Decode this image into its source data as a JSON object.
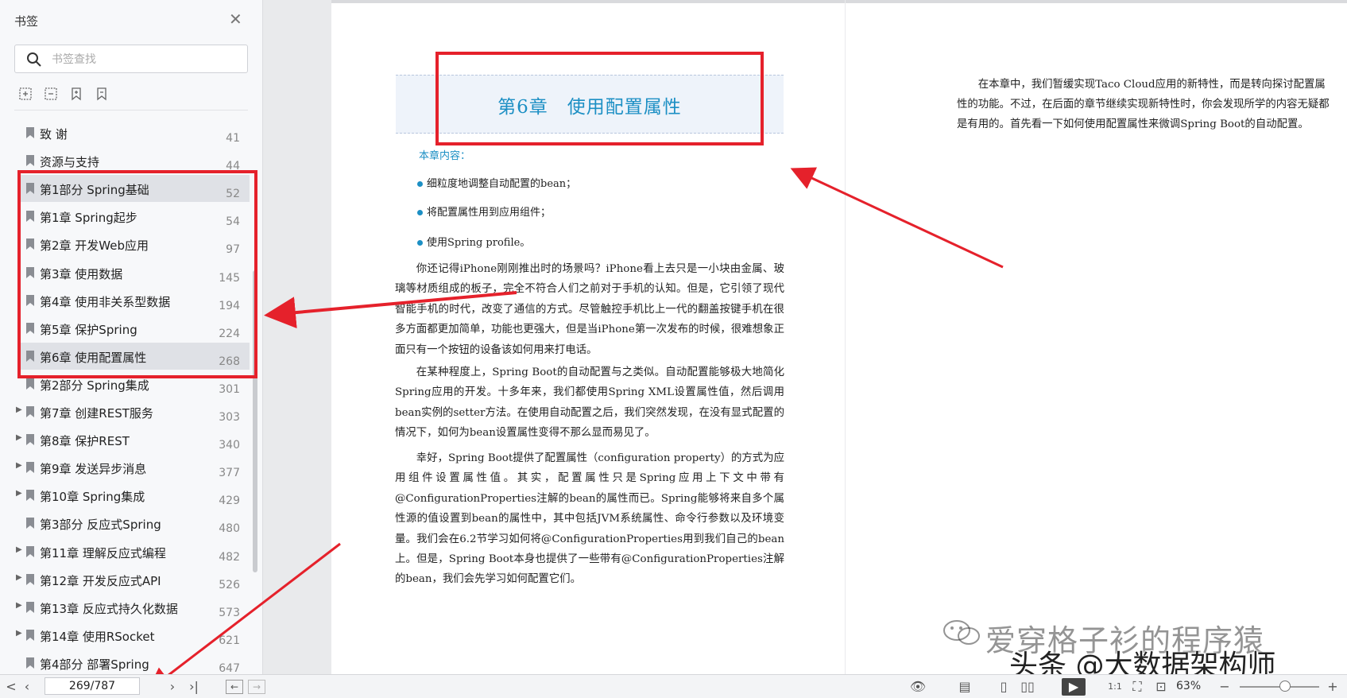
{
  "sidebar": {
    "title": "书签",
    "search_placeholder": "书签查找",
    "tools": [
      "expand-all-icon",
      "collapse-all-icon",
      "add-bookmark-icon",
      "remove-bookmark-icon"
    ],
    "items": [
      {
        "label": "致 谢",
        "page": "41",
        "expandable": false,
        "selected": false
      },
      {
        "label": "资源与支持",
        "page": "44",
        "expandable": false,
        "selected": false
      },
      {
        "label": "第1部分 Spring基础",
        "page": "52",
        "expandable": false,
        "selected": true
      },
      {
        "label": "第1章 Spring起步",
        "page": "54",
        "expandable": false,
        "selected": false
      },
      {
        "label": "第2章 开发Web应用",
        "page": "97",
        "expandable": false,
        "selected": false
      },
      {
        "label": "第3章 使用数据",
        "page": "145",
        "expandable": false,
        "selected": false
      },
      {
        "label": "第4章 使用非关系型数据",
        "page": "194",
        "expandable": false,
        "selected": false
      },
      {
        "label": "第5章 保护Spring",
        "page": "224",
        "expandable": false,
        "selected": false
      },
      {
        "label": "第6章 使用配置属性",
        "page": "268",
        "expandable": false,
        "selected": true
      },
      {
        "label": "第2部分 Spring集成",
        "page": "301",
        "expandable": false,
        "selected": false
      },
      {
        "label": "第7章 创建REST服务",
        "page": "303",
        "expandable": true,
        "selected": false
      },
      {
        "label": "第8章 保护REST",
        "page": "340",
        "expandable": true,
        "selected": false
      },
      {
        "label": "第9章 发送异步消息",
        "page": "377",
        "expandable": true,
        "selected": false
      },
      {
        "label": "第10章 Spring集成",
        "page": "429",
        "expandable": true,
        "selected": false
      },
      {
        "label": "第3部分 反应式Spring",
        "page": "480",
        "expandable": false,
        "selected": false
      },
      {
        "label": "第11章 理解反应式编程",
        "page": "482",
        "expandable": true,
        "selected": false
      },
      {
        "label": "第12章 开发反应式API",
        "page": "526",
        "expandable": true,
        "selected": false
      },
      {
        "label": "第13章 反应式持久化数据",
        "page": "573",
        "expandable": true,
        "selected": false
      },
      {
        "label": "第14章 使用RSocket",
        "page": "621",
        "expandable": true,
        "selected": false
      },
      {
        "label": "第4部分 部署Spring",
        "page": "647",
        "expandable": false,
        "selected": false
      }
    ]
  },
  "document": {
    "chapter_title": "第6章　使用配置属性",
    "contents_label": "本章内容：",
    "goals": [
      "细粒度地调整自动配置的bean；",
      "将配置属性用到应用组件；",
      "使用Spring profile。"
    ],
    "paragraphs": [
      "你还记得iPhone刚刚推出时的场景吗？iPhone看上去只是一小块由金属、玻璃等材质组成的板子，完全不符合人们之前对于手机的认知。但是，它引领了现代智能手机的时代，改变了通信的方式。尽管触控手机比上一代的翻盖按键手机在很多方面都更加简单，功能也更强大，但是当iPhone第一次发布的时候，很难想象正面只有一个按钮的设备该如何用来打电话。",
      "在某种程度上，Spring Boot的自动配置与之类似。自动配置能够极大地简化Spring应用的开发。十多年来，我们都使用Spring XML设置属性值，然后调用bean实例的setter方法。在使用自动配置之后，我们突然发现，在没有显式配置的情况下，如何为bean设置属性变得不那么显而易见了。",
      "幸好，Spring Boot提供了配置属性（configuration property）的方式为应用组件设置属性值。其实，配置属性只是Spring应用上下文中带有@ConfigurationProperties注解的bean的属性而已。Spring能够将来自多个属性源的值设置到bean的属性中，其中包括JVM系统属性、命令行参数以及环境变量。我们会在6.2节学习如何将@ConfigurationProperties用到我们自己的bean上。但是，Spring Boot本身也提供了一些带有@ConfigurationProperties注解的bean，我们会先学习如何配置它们。"
    ],
    "right_paragraph": "在本章中，我们暂缓实现Taco Cloud应用的新特性，而是转向探讨配置属性的功能。不过，在后面的章节继续实现新特性时，你会发现所学的内容无疑都是有用的。首先看一下如何使用配置属性来微调Spring Boot的自动配置。"
  },
  "watermark": {
    "text": "爱穿格子衫的程序猿",
    "brand": "头条 @大数据架构师"
  },
  "statusbar": {
    "page_display": "269/787",
    "zoom": "63%"
  },
  "colors": {
    "accent_blue": "#1c8fc4",
    "annotation_red": "#e5212b",
    "selected_row": "#dfe1e6"
  }
}
